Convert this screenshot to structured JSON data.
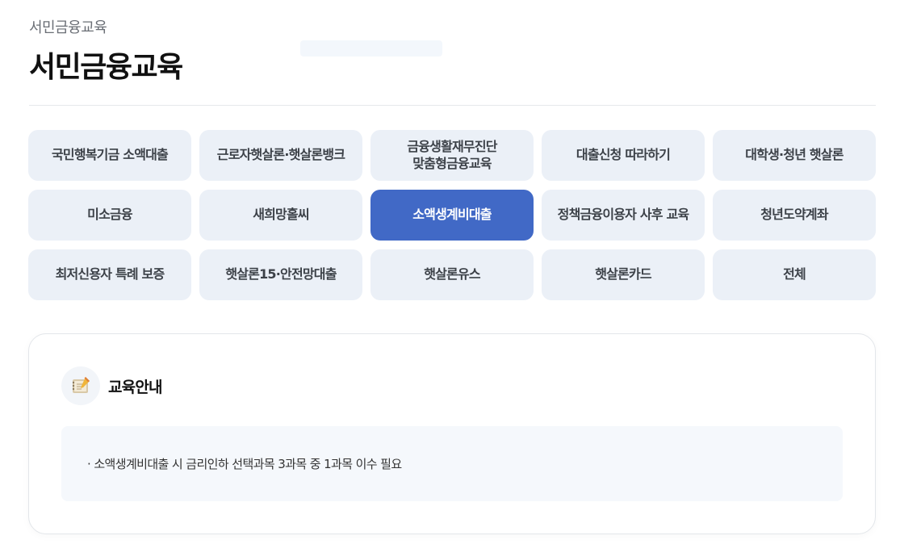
{
  "breadcrumb": "서민금융교육",
  "page_title": "서민금융교육",
  "menu": {
    "items": [
      {
        "label": "국민행복기금 소액대출",
        "active": false
      },
      {
        "label": "근로자햇살론·햇살론뱅크",
        "active": false
      },
      {
        "label": "금융생활재무진단\n맞춤형금융교육",
        "active": false
      },
      {
        "label": "대출신청 따라하기",
        "active": false
      },
      {
        "label": "대학생·청년 햇살론",
        "active": false
      },
      {
        "label": "미소금융",
        "active": false
      },
      {
        "label": "새희망홀씨",
        "active": false
      },
      {
        "label": "소액생계비대출",
        "active": true
      },
      {
        "label": "정책금융이용자 사후 교육",
        "active": false
      },
      {
        "label": "청년도약계좌",
        "active": false
      },
      {
        "label": "최저신용자 특례 보증",
        "active": false
      },
      {
        "label": "햇살론15·안전망대출",
        "active": false
      },
      {
        "label": "햇살론유스",
        "active": false
      },
      {
        "label": "햇살론카드",
        "active": false
      },
      {
        "label": "전체",
        "active": false
      }
    ]
  },
  "info": {
    "title": "교육안내",
    "icon": "notebook-icon",
    "text": "소액생계비대출 시 금리인하 선택과목 3과목 중 1과목 이수 필요"
  },
  "colors": {
    "active": "#4169c6",
    "button_bg": "#ebf0f7"
  }
}
